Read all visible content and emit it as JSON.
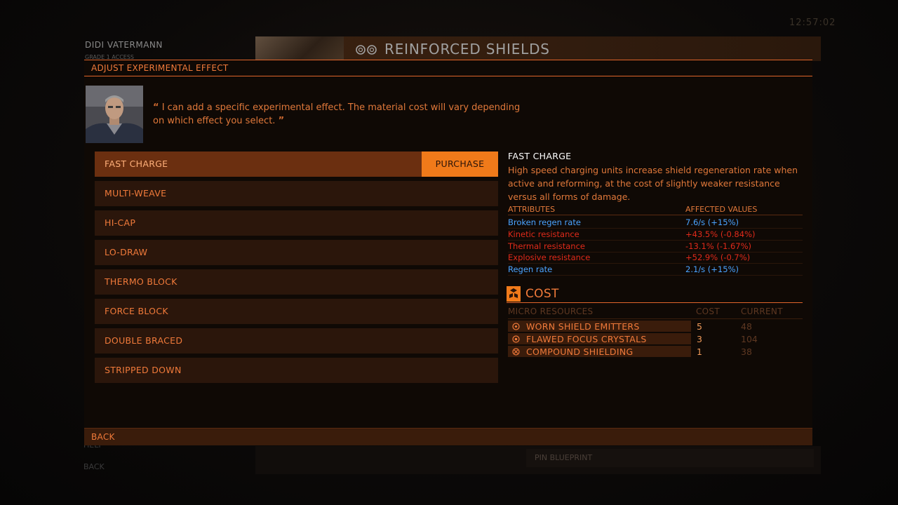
{
  "background": {
    "commander_name": "DIDI VATERMANN",
    "grade_access": "GRADE 1 ACCESS",
    "blueprint_title": "REINFORCED SHIELDS",
    "help_label": "HELP",
    "back_label": "BACK",
    "pin_label": "PIN BLUEPRINT",
    "clock": "12:57:02"
  },
  "modal": {
    "header": "ADJUST EXPERIMENTAL EFFECT",
    "quote": "I can add a specific experimental effect. The material cost will vary depending on which effect you select.",
    "open_quote": "“",
    "close_quote": "”",
    "options": [
      {
        "label": "FAST CHARGE",
        "selected": true
      },
      {
        "label": "MULTI-WEAVE",
        "selected": false
      },
      {
        "label": "HI-CAP",
        "selected": false
      },
      {
        "label": "LO-DRAW",
        "selected": false
      },
      {
        "label": "THERMO BLOCK",
        "selected": false
      },
      {
        "label": "FORCE BLOCK",
        "selected": false
      },
      {
        "label": "DOUBLE BRACED",
        "selected": false
      },
      {
        "label": "STRIPPED DOWN",
        "selected": false
      }
    ],
    "purchase_label": "PURCHASE",
    "back_label": "BACK"
  },
  "detail": {
    "title": "FAST CHARGE",
    "description": "High speed charging units increase shield regeneration rate when active and reforming, at the cost of slightly weaker resistance versus all forms of damage.",
    "attributes_header": "ATTRIBUTES",
    "values_header": "AFFECTED VALUES",
    "attributes": [
      {
        "name": "Broken regen rate",
        "value": "7.6/s (+15%)",
        "positive": true
      },
      {
        "name": "Kinetic resistance",
        "value": "+43.5% (-0.84%)",
        "positive": false
      },
      {
        "name": "Thermal resistance",
        "value": "-13.1% (-1.67%)",
        "positive": false
      },
      {
        "name": "Explosive resistance",
        "value": "+52.9% (-0.7%)",
        "positive": false
      },
      {
        "name": "Regen rate",
        "value": "2.1/s (+15%)",
        "positive": true
      }
    ]
  },
  "cost": {
    "title": "COST",
    "col_resources": "MICRO RESOURCES",
    "col_cost": "COST",
    "col_current": "CURRENT",
    "items": [
      {
        "name": "WORN SHIELD EMITTERS",
        "cost": "5",
        "current": "48",
        "icon": "emitter-icon"
      },
      {
        "name": "FLAWED FOCUS CRYSTALS",
        "cost": "3",
        "current": "104",
        "icon": "crystal-icon"
      },
      {
        "name": "COMPOUND SHIELDING",
        "cost": "1",
        "current": "38",
        "icon": "shielding-icon"
      }
    ]
  },
  "colors": {
    "accent": "#f07a3a",
    "purchase": "#f07a1a",
    "positive": "#4aa3ff",
    "negative": "#e02a1a"
  }
}
